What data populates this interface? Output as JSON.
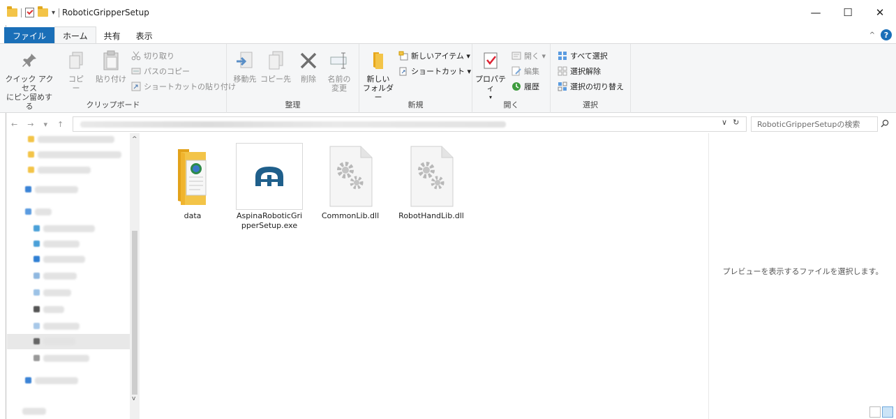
{
  "window": {
    "title": "RoboticGripperSetup",
    "minimize": "—",
    "maximize": "☐",
    "close": "✕"
  },
  "tabs": [
    {
      "label": "ファイル"
    },
    {
      "label": "ホーム"
    },
    {
      "label": "共有"
    },
    {
      "label": "表示"
    }
  ],
  "ribbon": {
    "clipboard": {
      "group_label": "クリップボード",
      "pin_line1": "クイック アクセス",
      "pin_line2": "にピン留めする",
      "copy": "コピー",
      "paste": "貼り付け",
      "cut": "切り取り",
      "copy_path": "パスのコピー",
      "paste_shortcut": "ショートカットの貼り付け"
    },
    "organize": {
      "group_label": "整理",
      "move_to": "移動先",
      "copy_to": "コピー先",
      "delete": "削除",
      "rename_line1": "名前の",
      "rename_line2": "変更"
    },
    "new": {
      "group_label": "新規",
      "new_folder_line1": "新しい",
      "new_folder_line2": "フォルダー",
      "new_item": "新しいアイテム ▾",
      "easy_access": "ショートカット ▾"
    },
    "open": {
      "group_label": "開く",
      "properties": "プロパティ",
      "open": "開く ▾",
      "edit": "編集",
      "history": "履歴"
    },
    "select": {
      "group_label": "選択",
      "select_all": "すべて選択",
      "select_none": "選択解除",
      "invert": "選択の切り替え"
    }
  },
  "search": {
    "placeholder": "RoboticGripperSetupの検索"
  },
  "files": [
    {
      "name": "data",
      "type": "folder"
    },
    {
      "name": "AspinaRoboticGripperSetup.exe",
      "type": "exe"
    },
    {
      "name": "CommonLib.dll",
      "type": "dll"
    },
    {
      "name": "RobotHandLib.dll",
      "type": "dll"
    }
  ],
  "preview": {
    "message": "プレビューを表示するファイルを選択します。"
  },
  "colors": {
    "accent": "#1a6fb8",
    "folder": "#f3c448",
    "exe_icon": "#1f5f8b"
  }
}
